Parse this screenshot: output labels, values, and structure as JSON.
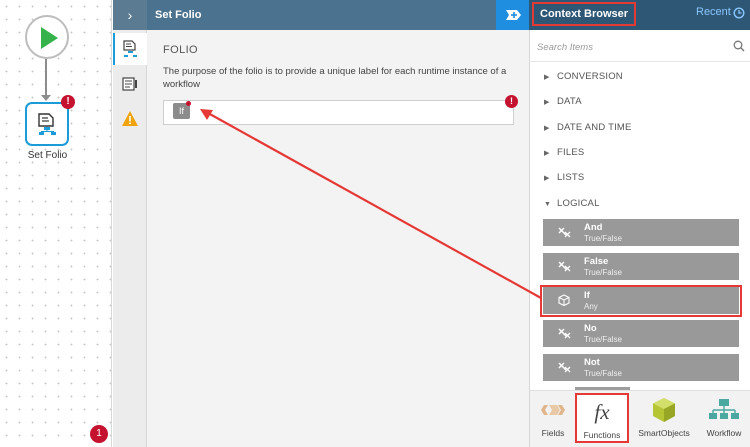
{
  "canvas": {
    "start_node_icon": "play-icon",
    "folio_node_icon": "folio-step-icon",
    "folio_node_label": "Set Folio",
    "folio_node_error": "!",
    "error_counter": "1"
  },
  "editor": {
    "collapse_icon": "chevron-right-icon",
    "title": "Set Folio",
    "expand_icon": "expand-panel-icon",
    "section_title": "FOLIO",
    "description": "The purpose of the folio is to provide a unique label for each runtime instance of a workflow",
    "token_label": "If",
    "field_error": "!",
    "rail_tabs": [
      "properties-icon",
      "input-output-icon",
      "warning-icon"
    ]
  },
  "context_browser": {
    "title": "Context Browser",
    "recent_label": "Recent",
    "recent_icon": "clock-icon",
    "search_placeholder": "Search Items",
    "categories": [
      {
        "label": "CONVERSION",
        "expanded": false
      },
      {
        "label": "DATA",
        "expanded": false
      },
      {
        "label": "DATE AND TIME",
        "expanded": false
      },
      {
        "label": "FILES",
        "expanded": false
      },
      {
        "label": "LISTS",
        "expanded": false
      },
      {
        "label": "LOGICAL",
        "expanded": true
      }
    ],
    "functions": [
      {
        "name": "And",
        "type": "True/False",
        "icon": "logic-function-icon"
      },
      {
        "name": "False",
        "type": "True/False",
        "icon": "logic-function-icon"
      },
      {
        "name": "If",
        "type": "Any",
        "icon": "cube-icon"
      },
      {
        "name": "No",
        "type": "True/False",
        "icon": "logic-function-icon"
      },
      {
        "name": "Not",
        "type": "True/False",
        "icon": "logic-function-icon"
      }
    ],
    "tabs": [
      {
        "label": "Fields",
        "icon": "fields-icon"
      },
      {
        "label": "Functions",
        "icon": "fx-icon"
      },
      {
        "label": "SmartObjects",
        "icon": "smartobject-cube-icon"
      },
      {
        "label": "Workflow",
        "icon": "workflow-tree-icon"
      }
    ]
  },
  "colors": {
    "header": "#4b728e",
    "context_header": "#2e5775",
    "accent_blue": "#1f8ee0",
    "error_red": "#c4122f",
    "annotation_red": "#e53935",
    "function_item": "#999999",
    "start_green": "#35b34a"
  }
}
